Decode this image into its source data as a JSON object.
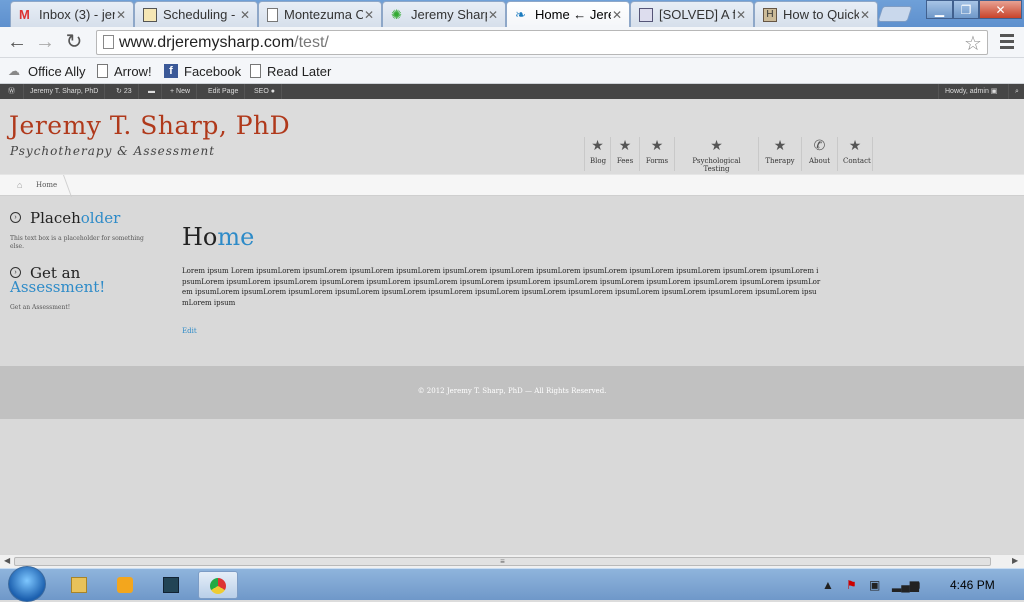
{
  "browser": {
    "tabs": [
      {
        "title": "Inbox (3) - jere",
        "icon": "gmail-icon"
      },
      {
        "title": "Scheduling - ",
        "icon": "calendar-icon"
      },
      {
        "title": "Montezuma C",
        "icon": "page-icon"
      },
      {
        "title": "Jeremy Sharp",
        "icon": "leaf-icon"
      },
      {
        "title": "Home ← Jerer",
        "icon": "wordpress-icon"
      },
      {
        "title": "[SOLVED] A fe",
        "icon": "forum-icon"
      },
      {
        "title": "How to Quick",
        "icon": "wikihow-icon"
      }
    ],
    "url_host": "www.drjeremysharp.com",
    "url_path": "/test/",
    "bookmarks": [
      "Office Ally",
      "Arrow!",
      "Facebook",
      "Read Later"
    ]
  },
  "admin_bar": {
    "site_name": "Jeremy T. Sharp, PhD",
    "updates": "23",
    "new_label": "+ New",
    "edit_label": "Edit Page",
    "seo_label": "SEO",
    "howdy": "Howdy, admin"
  },
  "site": {
    "title": "Jeremy T. Sharp, PhD",
    "tagline": "Psychotherapy & Assessment",
    "nav": [
      "Blog",
      "Fees",
      "Forms",
      "Psychological Testing",
      "Therapy",
      "About",
      "Contact"
    ],
    "breadcrumb": "Home",
    "sidebar": {
      "widget1_title_a": "Placeh",
      "widget1_title_b": "older",
      "widget1_text": "This text box is a placeholder for something else.",
      "widget2_title_a": "Get an",
      "widget2_title_b": "Assessment!",
      "widget2_text": "Get an Assessment!"
    },
    "page_title_a": "Ho",
    "page_title_b": "me",
    "body_text": "Lorem ipsum Lorem ipsumLorem ipsumLorem ipsumLorem ipsumLorem ipsumLorem ipsumLorem ipsumLorem ipsumLorem ipsumLorem ipsumLorem ipsumLorem ipsumLorem ipsumLorem ipsumLorem ipsumLorem ipsumLorem ipsumLorem ipsumLorem ipsumLorem ipsumLorem ipsumLorem ipsumLorem ipsumLorem ipsumLorem ipsumLorem ipsumLorem ipsumLorem ipsumLorem ipsumLorem ipsumLorem ipsumLorem ipsumLorem ipsumLorem ipsumLorem ipsumLorem ipsumLorem ipsumLorem ipsumLorem ipsumLorem ipsumLorem ipsum",
    "edit_link": "Edit",
    "footer": "© 2012 Jeremy T. Sharp, PhD — All Rights Reserved."
  },
  "taskbar": {
    "clock": "4:46 PM"
  },
  "colors": {
    "brand_red": "#b0391b",
    "accent_blue": "#2e8bc8"
  }
}
